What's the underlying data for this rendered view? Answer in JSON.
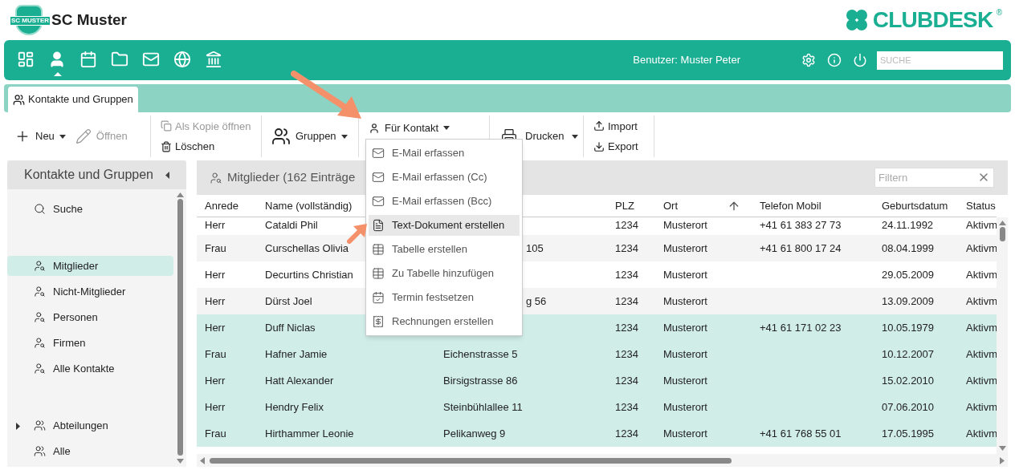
{
  "header": {
    "badge": "SC MUSTER",
    "club_name": "SC Muster",
    "brand": "CLUBDESK",
    "brand_mark": "®"
  },
  "nav": {
    "icons": [
      {
        "kind": "dashboard",
        "selected": false
      },
      {
        "kind": "person",
        "selected": true
      },
      {
        "kind": "calendar",
        "selected": false
      },
      {
        "kind": "folder",
        "selected": false
      },
      {
        "kind": "mail",
        "selected": false
      },
      {
        "kind": "globe",
        "selected": false
      },
      {
        "kind": "bank",
        "selected": false
      }
    ],
    "user": "Benutzer: Muster Peter",
    "search": {
      "placeholder": "SUCHE"
    }
  },
  "tabs": [
    {
      "label": "Kontakte und Gruppen",
      "selected": true
    }
  ],
  "toolbar": {
    "new": {
      "label": "Neu",
      "disabled": false
    },
    "open": {
      "label": "Öffnen",
      "disabled": true
    },
    "copy": {
      "label": "Als Kopie öffnen",
      "disabled": true
    },
    "delete": {
      "label": "Löschen",
      "disabled": false
    },
    "groups": {
      "label": "Gruppen"
    },
    "contact": {
      "label": "Für Kontakt",
      "expanded": true
    },
    "print": {
      "label": "Drucken"
    },
    "import": {
      "label": "Import"
    },
    "export": {
      "label": "Export"
    }
  },
  "menu": [
    {
      "kind": "mail",
      "label": "E-Mail erfassen",
      "selected": false
    },
    {
      "kind": "mail",
      "label": "E-Mail erfassen (Cc)",
      "selected": false
    },
    {
      "kind": "mail",
      "label": "E-Mail erfassen (Bcc)",
      "selected": false
    },
    {
      "kind": "document",
      "label": "Text-Dokument erstellen",
      "selected": true
    },
    {
      "kind": "table",
      "label": "Tabelle erstellen",
      "selected": false
    },
    {
      "kind": "table",
      "label": "Zu Tabelle hinzufügen",
      "selected": false
    },
    {
      "kind": "calendar",
      "label": "Termin festsetzen",
      "selected": false
    },
    {
      "kind": "invoice",
      "label": "Rechnungen erstellen",
      "selected": false
    }
  ],
  "sidebar": {
    "title": "Kontakte und Gruppen",
    "sections": [
      [
        {
          "kind": "search",
          "label": "Suche",
          "selected": false
        }
      ],
      [
        {
          "kind": "member",
          "label": "Mitglieder",
          "selected": true
        },
        {
          "kind": "member",
          "label": "Nicht-Mitglieder",
          "selected": false
        },
        {
          "kind": "member",
          "label": "Personen",
          "selected": false
        },
        {
          "kind": "member",
          "label": "Firmen",
          "selected": false
        },
        {
          "kind": "member",
          "label": "Alle Kontakte",
          "selected": false
        }
      ],
      [
        {
          "kind": "group",
          "label": "Abteilungen",
          "selected": false,
          "expanded": false
        },
        {
          "kind": "group",
          "label": "Alle",
          "selected": false
        }
      ]
    ]
  },
  "table": {
    "title": "Mitglieder (162 Einträge",
    "filter": {
      "placeholder": "Filtern"
    },
    "columns": [
      {
        "label": "Anrede",
        "sorted": false
      },
      {
        "label": "Name (vollständig)",
        "sorted": false
      },
      {},
      {
        "label": "PLZ",
        "sorted": false
      },
      {
        "label": "Ort",
        "sorted": true
      },
      {
        "label": "Telefon Mobil",
        "sorted": false
      },
      {
        "label": "Geburtsdatum",
        "sorted": false
      },
      {
        "label": "Status",
        "sorted": false
      }
    ],
    "rows": [
      {
        "selected": false,
        "cells": [
          "Herr",
          "Cataldi Phil",
          "",
          "1234",
          "Musterort",
          "+41 61 383 27 73",
          "24.11.1992",
          "Aktivm"
        ]
      },
      {
        "selected": false,
        "cells": [
          "Frau",
          "Curschellas Olivia",
          "105",
          "1234",
          "Musterort",
          "+41 61 800 17 24",
          "08.04.1999",
          "Aktivm"
        ]
      },
      {
        "selected": false,
        "cells": [
          "Herr",
          "Decurtins Christian",
          "",
          "1234",
          "Musterort",
          "",
          "29.05.2009",
          "Aktivm"
        ]
      },
      {
        "selected": false,
        "cells": [
          "Herr",
          "Dürst Joel",
          "g 56",
          "1234",
          "Musterort",
          "",
          "13.09.2009",
          "Aktivm"
        ]
      },
      {
        "selected": true,
        "cells": [
          "Herr",
          "Duff Niclas",
          "",
          "1234",
          "Musterort",
          "+41 61 171 02 23",
          "10.05.1979",
          "Aktivm"
        ]
      },
      {
        "selected": true,
        "cells": [
          "Frau",
          "Hafner Jamie",
          "Eichenstrasse 5",
          "1234",
          "Musterort",
          "",
          "10.12.2007",
          "Aktivm"
        ]
      },
      {
        "selected": true,
        "cells": [
          "Herr",
          "Hatt Alexander",
          "Birsigstrasse 86",
          "1234",
          "Musterort",
          "",
          "15.02.2010",
          "Aktivm"
        ]
      },
      {
        "selected": true,
        "cells": [
          "Herr",
          "Hendry Felix",
          "Steinbühlallee 11",
          "1234",
          "Musterort",
          "",
          "07.06.2010",
          "Aktivm"
        ]
      },
      {
        "selected": true,
        "cells": [
          "Frau",
          "Hirthammer Leonie",
          "Pelikanweg 9",
          "1234",
          "Musterort",
          "+41 61 768 55 01",
          "17.05.1995",
          "Aktivm"
        ]
      }
    ]
  }
}
